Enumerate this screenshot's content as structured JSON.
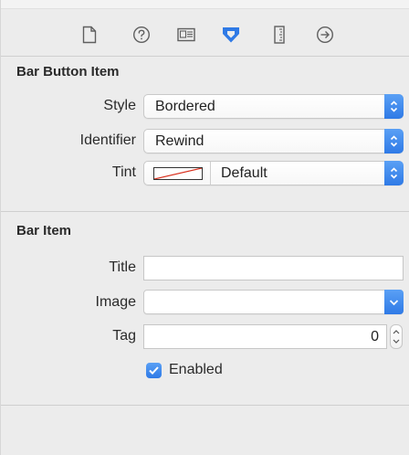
{
  "tabs": [
    {
      "name": "file-inspector-icon"
    },
    {
      "name": "quick-help-icon"
    },
    {
      "name": "identity-inspector-icon"
    },
    {
      "name": "attributes-inspector-icon"
    },
    {
      "name": "size-inspector-icon"
    },
    {
      "name": "connections-inspector-icon"
    }
  ],
  "colors": {
    "accent": "#2f7ae6",
    "tab_active": "#2f7ae6",
    "tab_inactive": "#5f5f5f"
  },
  "bar_button_item": {
    "title": "Bar Button Item",
    "style": {
      "label": "Style",
      "value": "Bordered"
    },
    "identifier": {
      "label": "Identifier",
      "value": "Rewind"
    },
    "tint": {
      "label": "Tint",
      "value": "Default"
    }
  },
  "bar_item": {
    "title": "Bar Item",
    "title_field": {
      "label": "Title",
      "value": ""
    },
    "image": {
      "label": "Image",
      "value": ""
    },
    "tag": {
      "label": "Tag",
      "value": "0"
    },
    "enabled": {
      "label": "Enabled",
      "checked": true
    }
  }
}
